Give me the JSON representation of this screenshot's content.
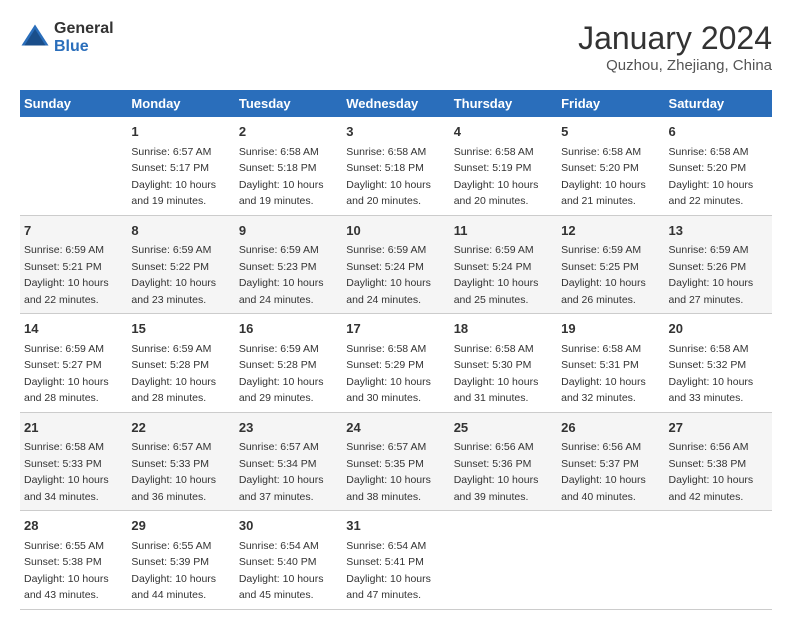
{
  "header": {
    "logo_line1": "General",
    "logo_line2": "Blue",
    "month_title": "January 2024",
    "location": "Quzhou, Zhejiang, China"
  },
  "weekdays": [
    "Sunday",
    "Monday",
    "Tuesday",
    "Wednesday",
    "Thursday",
    "Friday",
    "Saturday"
  ],
  "weeks": [
    [
      null,
      {
        "day": "1",
        "sunrise": "6:57 AM",
        "sunset": "5:17 PM",
        "daylight": "10 hours and 19 minutes."
      },
      {
        "day": "2",
        "sunrise": "6:58 AM",
        "sunset": "5:18 PM",
        "daylight": "10 hours and 19 minutes."
      },
      {
        "day": "3",
        "sunrise": "6:58 AM",
        "sunset": "5:18 PM",
        "daylight": "10 hours and 20 minutes."
      },
      {
        "day": "4",
        "sunrise": "6:58 AM",
        "sunset": "5:19 PM",
        "daylight": "10 hours and 20 minutes."
      },
      {
        "day": "5",
        "sunrise": "6:58 AM",
        "sunset": "5:20 PM",
        "daylight": "10 hours and 21 minutes."
      },
      {
        "day": "6",
        "sunrise": "6:58 AM",
        "sunset": "5:20 PM",
        "daylight": "10 hours and 22 minutes."
      }
    ],
    [
      {
        "day": "7",
        "sunrise": "6:59 AM",
        "sunset": "5:21 PM",
        "daylight": "10 hours and 22 minutes."
      },
      {
        "day": "8",
        "sunrise": "6:59 AM",
        "sunset": "5:22 PM",
        "daylight": "10 hours and 23 minutes."
      },
      {
        "day": "9",
        "sunrise": "6:59 AM",
        "sunset": "5:23 PM",
        "daylight": "10 hours and 24 minutes."
      },
      {
        "day": "10",
        "sunrise": "6:59 AM",
        "sunset": "5:24 PM",
        "daylight": "10 hours and 24 minutes."
      },
      {
        "day": "11",
        "sunrise": "6:59 AM",
        "sunset": "5:24 PM",
        "daylight": "10 hours and 25 minutes."
      },
      {
        "day": "12",
        "sunrise": "6:59 AM",
        "sunset": "5:25 PM",
        "daylight": "10 hours and 26 minutes."
      },
      {
        "day": "13",
        "sunrise": "6:59 AM",
        "sunset": "5:26 PM",
        "daylight": "10 hours and 27 minutes."
      }
    ],
    [
      {
        "day": "14",
        "sunrise": "6:59 AM",
        "sunset": "5:27 PM",
        "daylight": "10 hours and 28 minutes."
      },
      {
        "day": "15",
        "sunrise": "6:59 AM",
        "sunset": "5:28 PM",
        "daylight": "10 hours and 28 minutes."
      },
      {
        "day": "16",
        "sunrise": "6:59 AM",
        "sunset": "5:28 PM",
        "daylight": "10 hours and 29 minutes."
      },
      {
        "day": "17",
        "sunrise": "6:58 AM",
        "sunset": "5:29 PM",
        "daylight": "10 hours and 30 minutes."
      },
      {
        "day": "18",
        "sunrise": "6:58 AM",
        "sunset": "5:30 PM",
        "daylight": "10 hours and 31 minutes."
      },
      {
        "day": "19",
        "sunrise": "6:58 AM",
        "sunset": "5:31 PM",
        "daylight": "10 hours and 32 minutes."
      },
      {
        "day": "20",
        "sunrise": "6:58 AM",
        "sunset": "5:32 PM",
        "daylight": "10 hours and 33 minutes."
      }
    ],
    [
      {
        "day": "21",
        "sunrise": "6:58 AM",
        "sunset": "5:33 PM",
        "daylight": "10 hours and 34 minutes."
      },
      {
        "day": "22",
        "sunrise": "6:57 AM",
        "sunset": "5:33 PM",
        "daylight": "10 hours and 36 minutes."
      },
      {
        "day": "23",
        "sunrise": "6:57 AM",
        "sunset": "5:34 PM",
        "daylight": "10 hours and 37 minutes."
      },
      {
        "day": "24",
        "sunrise": "6:57 AM",
        "sunset": "5:35 PM",
        "daylight": "10 hours and 38 minutes."
      },
      {
        "day": "25",
        "sunrise": "6:56 AM",
        "sunset": "5:36 PM",
        "daylight": "10 hours and 39 minutes."
      },
      {
        "day": "26",
        "sunrise": "6:56 AM",
        "sunset": "5:37 PM",
        "daylight": "10 hours and 40 minutes."
      },
      {
        "day": "27",
        "sunrise": "6:56 AM",
        "sunset": "5:38 PM",
        "daylight": "10 hours and 42 minutes."
      }
    ],
    [
      {
        "day": "28",
        "sunrise": "6:55 AM",
        "sunset": "5:38 PM",
        "daylight": "10 hours and 43 minutes."
      },
      {
        "day": "29",
        "sunrise": "6:55 AM",
        "sunset": "5:39 PM",
        "daylight": "10 hours and 44 minutes."
      },
      {
        "day": "30",
        "sunrise": "6:54 AM",
        "sunset": "5:40 PM",
        "daylight": "10 hours and 45 minutes."
      },
      {
        "day": "31",
        "sunrise": "6:54 AM",
        "sunset": "5:41 PM",
        "daylight": "10 hours and 47 minutes."
      },
      null,
      null,
      null
    ]
  ]
}
